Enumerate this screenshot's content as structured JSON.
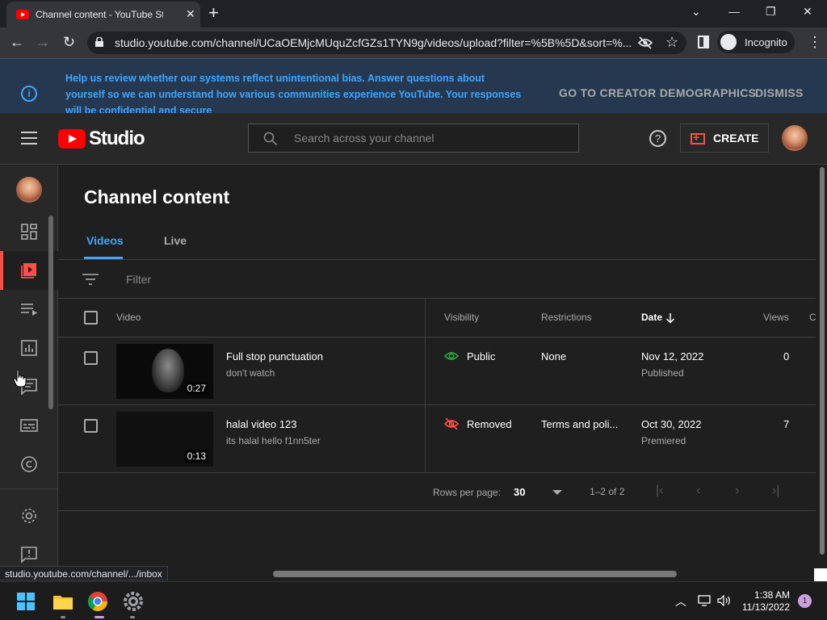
{
  "browser": {
    "tab_title": "Channel content - YouTube Studio",
    "url": "studio.youtube.com/channel/UCaOEMjcMUquZcfGZs1TYN9g/videos/upload?filter=%5B%5D&sort=%...",
    "incognito_label": "Incognito",
    "status_url": "studio.youtube.com/channel/.../inbox"
  },
  "banner": {
    "message": "Help us review whether our systems reflect unintentional bias. Answer questions about yourself so we can understand how various communities experience YouTube. Your responses will be confidential and secure",
    "action_label": "GO TO CREATOR DEMOGRAPHICS",
    "dismiss_label": "DISMISS"
  },
  "header": {
    "logo_text": "Studio",
    "search_placeholder": "Search across your channel",
    "create_label": "CREATE"
  },
  "sidebar": {
    "items": [
      "dashboard",
      "content",
      "playlists",
      "analytics",
      "comments",
      "subtitles",
      "copyright",
      "settings",
      "feedback"
    ]
  },
  "page": {
    "title": "Channel content",
    "tabs": [
      "Videos",
      "Live"
    ],
    "active_tab": "Videos",
    "filter_placeholder": "Filter"
  },
  "table": {
    "headers": {
      "video": "Video",
      "visibility": "Visibility",
      "restrictions": "Restrictions",
      "date": "Date",
      "views": "Views",
      "next": "C"
    },
    "rows": [
      {
        "title": "Full stop punctuation",
        "description": "don't watch",
        "duration": "0:27",
        "visibility": "Public",
        "restrictions": "None",
        "date": "Nov 12, 2022",
        "date_status": "Published",
        "views": "0"
      },
      {
        "title": "halal video 123",
        "description": "its halal hello f1nn5ter",
        "duration": "0:13",
        "visibility": "Removed",
        "restrictions": "Terms and poli...",
        "date": "Oct 30, 2022",
        "date_status": "Premiered",
        "views": "7"
      }
    ]
  },
  "pagination": {
    "rows_per_page_label": "Rows per page:",
    "rows_per_page": "30",
    "range": "1–2 of 2"
  },
  "taskbar": {
    "time": "1:38 AM",
    "date": "11/13/2022",
    "notification_count": "1"
  },
  "colors": {
    "accent_blue": "#3ea6ff",
    "youtube_red": "#ff0000",
    "public_green": "#2ba640",
    "removed_red": "#ff4e45"
  }
}
